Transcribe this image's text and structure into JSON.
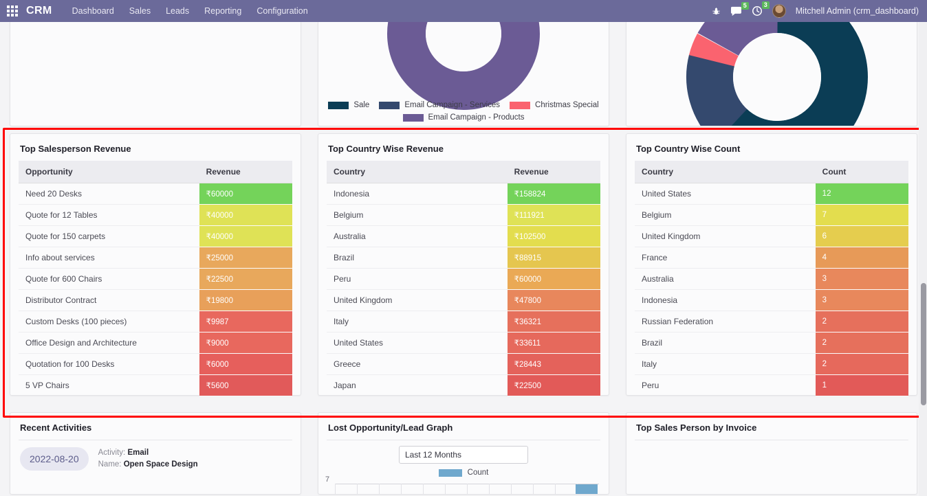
{
  "navbar": {
    "apps_icon": "apps-grid-icon",
    "brand": "CRM",
    "links": [
      "Dashboard",
      "Sales",
      "Leads",
      "Reporting",
      "Configuration"
    ],
    "bug_icon": "bug-icon",
    "messages_icon": "messages-icon",
    "messages_count": "5",
    "activities_icon": "clock-icon",
    "activities_count": "3",
    "avatar": "user-avatar",
    "user": "Mitchell Admin (crm_dashboard)",
    "bg_color": "#6b6a9a",
    "badge_color": "#5cb85c"
  },
  "highlight": {
    "color": "#ff0000"
  },
  "charts": {
    "legend_title_colors": {
      "sale": "#0b3d55",
      "email_services": "#34496e",
      "christmas": "#fa636f",
      "email_products": "#6b5b95"
    },
    "legend": [
      {
        "label": "Sale",
        "color": "#0b3d55"
      },
      {
        "label": "Email Campaign - Services",
        "color": "#34496e"
      },
      {
        "label": "Christmas Special",
        "color": "#fa636f"
      },
      {
        "label": "Email Campaign - Products",
        "color": "#6b5b95"
      }
    ]
  },
  "chart_data": [
    {
      "type": "pie",
      "title": "",
      "labels": [
        "Email Campaign - Products"
      ],
      "values": [
        100
      ],
      "colors": [
        "#6b5b95"
      ],
      "legend_position": "bottom",
      "note": "donut chart clipped at top of viewport"
    },
    {
      "type": "pie",
      "title": "",
      "labels": [
        "Sale",
        "Email Campaign - Services",
        "Christmas Special",
        "Email Campaign - Products"
      ],
      "values": [
        62,
        17,
        4,
        17
      ],
      "colors": [
        "#0b3d55",
        "#34496e",
        "#fa636f",
        "#6b5b95"
      ],
      "legend_position": "none",
      "note": "donut chart clipped at top of viewport"
    },
    {
      "type": "bar",
      "title": "Lost Opportunity/Lead Graph",
      "series": [
        {
          "name": "Count",
          "values": [
            null
          ]
        }
      ],
      "categories": [],
      "ylabel": "",
      "xlabel": "",
      "ylim": [
        0,
        7
      ],
      "ytick_visible": "7",
      "legend_position": "top",
      "grid": true,
      "note": "graph clipped at bottom of viewport; only top gridline labelled 7 visible"
    }
  ],
  "tables": [
    {
      "title": "Top Salesperson Revenue",
      "columns": [
        "Opportunity",
        "Revenue"
      ],
      "rows": [
        {
          "key": "Need 20 Desks",
          "value": "₹60000",
          "color": "#74d35a"
        },
        {
          "key": "Quote for 12 Tables",
          "value": "₹40000",
          "color": "#dfe256"
        },
        {
          "key": "Quote for 150 carpets",
          "value": "₹40000",
          "color": "#dfe256"
        },
        {
          "key": "Info about services",
          "value": "₹25000",
          "color": "#e8a85c"
        },
        {
          "key": "Quote for 600 Chairs",
          "value": "₹22500",
          "color": "#e8a85c"
        },
        {
          "key": "Distributor Contract",
          "value": "₹19800",
          "color": "#e8a05a"
        },
        {
          "key": "Custom Desks (100 pieces)",
          "value": "₹9987",
          "color": "#e8685e"
        },
        {
          "key": "Office Design and Architecture",
          "value": "₹9000",
          "color": "#e8685e"
        },
        {
          "key": "Quotation for 100 Desks",
          "value": "₹6000",
          "color": "#e65f5c"
        },
        {
          "key": "5 VP Chairs",
          "value": "₹5600",
          "color": "#e15a5a"
        }
      ]
    },
    {
      "title": "Top Country Wise Revenue",
      "columns": [
        "Country",
        "Revenue"
      ],
      "rows": [
        {
          "key": "Indonesia",
          "value": "₹158824",
          "color": "#74d35a"
        },
        {
          "key": "Belgium",
          "value": "₹111921",
          "color": "#dfe256"
        },
        {
          "key": "Australia",
          "value": "₹102500",
          "color": "#e3dd4e"
        },
        {
          "key": "Brazil",
          "value": "₹88915",
          "color": "#e5c64f"
        },
        {
          "key": "Peru",
          "value": "₹60000",
          "color": "#eaa955"
        },
        {
          "key": "United Kingdom",
          "value": "₹47800",
          "color": "#e8875c"
        },
        {
          "key": "Italy",
          "value": "₹36321",
          "color": "#e6705c"
        },
        {
          "key": "United States",
          "value": "₹33611",
          "color": "#e6695c"
        },
        {
          "key": "Greece",
          "value": "₹28443",
          "color": "#e4625b"
        },
        {
          "key": "Japan",
          "value": "₹22500",
          "color": "#e25a58"
        }
      ]
    },
    {
      "title": "Top Country Wise Count",
      "columns": [
        "Country",
        "Count"
      ],
      "rows": [
        {
          "key": "United States",
          "value": "12",
          "color": "#74d35a"
        },
        {
          "key": "Belgium",
          "value": "7",
          "color": "#e3dd4e"
        },
        {
          "key": "United Kingdom",
          "value": "6",
          "color": "#e5cd4e"
        },
        {
          "key": "France",
          "value": "4",
          "color": "#e79a58"
        },
        {
          "key": "Australia",
          "value": "3",
          "color": "#e8885c"
        },
        {
          "key": "Indonesia",
          "value": "3",
          "color": "#e8885c"
        },
        {
          "key": "Russian Federation",
          "value": "2",
          "color": "#e6705c"
        },
        {
          "key": "Brazil",
          "value": "2",
          "color": "#e6705c"
        },
        {
          "key": "Italy",
          "value": "2",
          "color": "#e6695c"
        },
        {
          "key": "Peru",
          "value": "1",
          "color": "#e25a58"
        }
      ]
    }
  ],
  "bottom": {
    "recent_activities": {
      "title": "Recent Activities",
      "item": {
        "date": "2022-08-20",
        "activity_label": "Activity:",
        "activity_value": "Email",
        "name_label": "Name:",
        "name_value": "Open Space Design"
      }
    },
    "lost_graph": {
      "title": "Lost Opportunity/Lead Graph",
      "period": "Last 12 Months",
      "legend": "Count",
      "y_tick": "7"
    },
    "top_invoice": {
      "title": "Top Sales Person by Invoice"
    }
  }
}
